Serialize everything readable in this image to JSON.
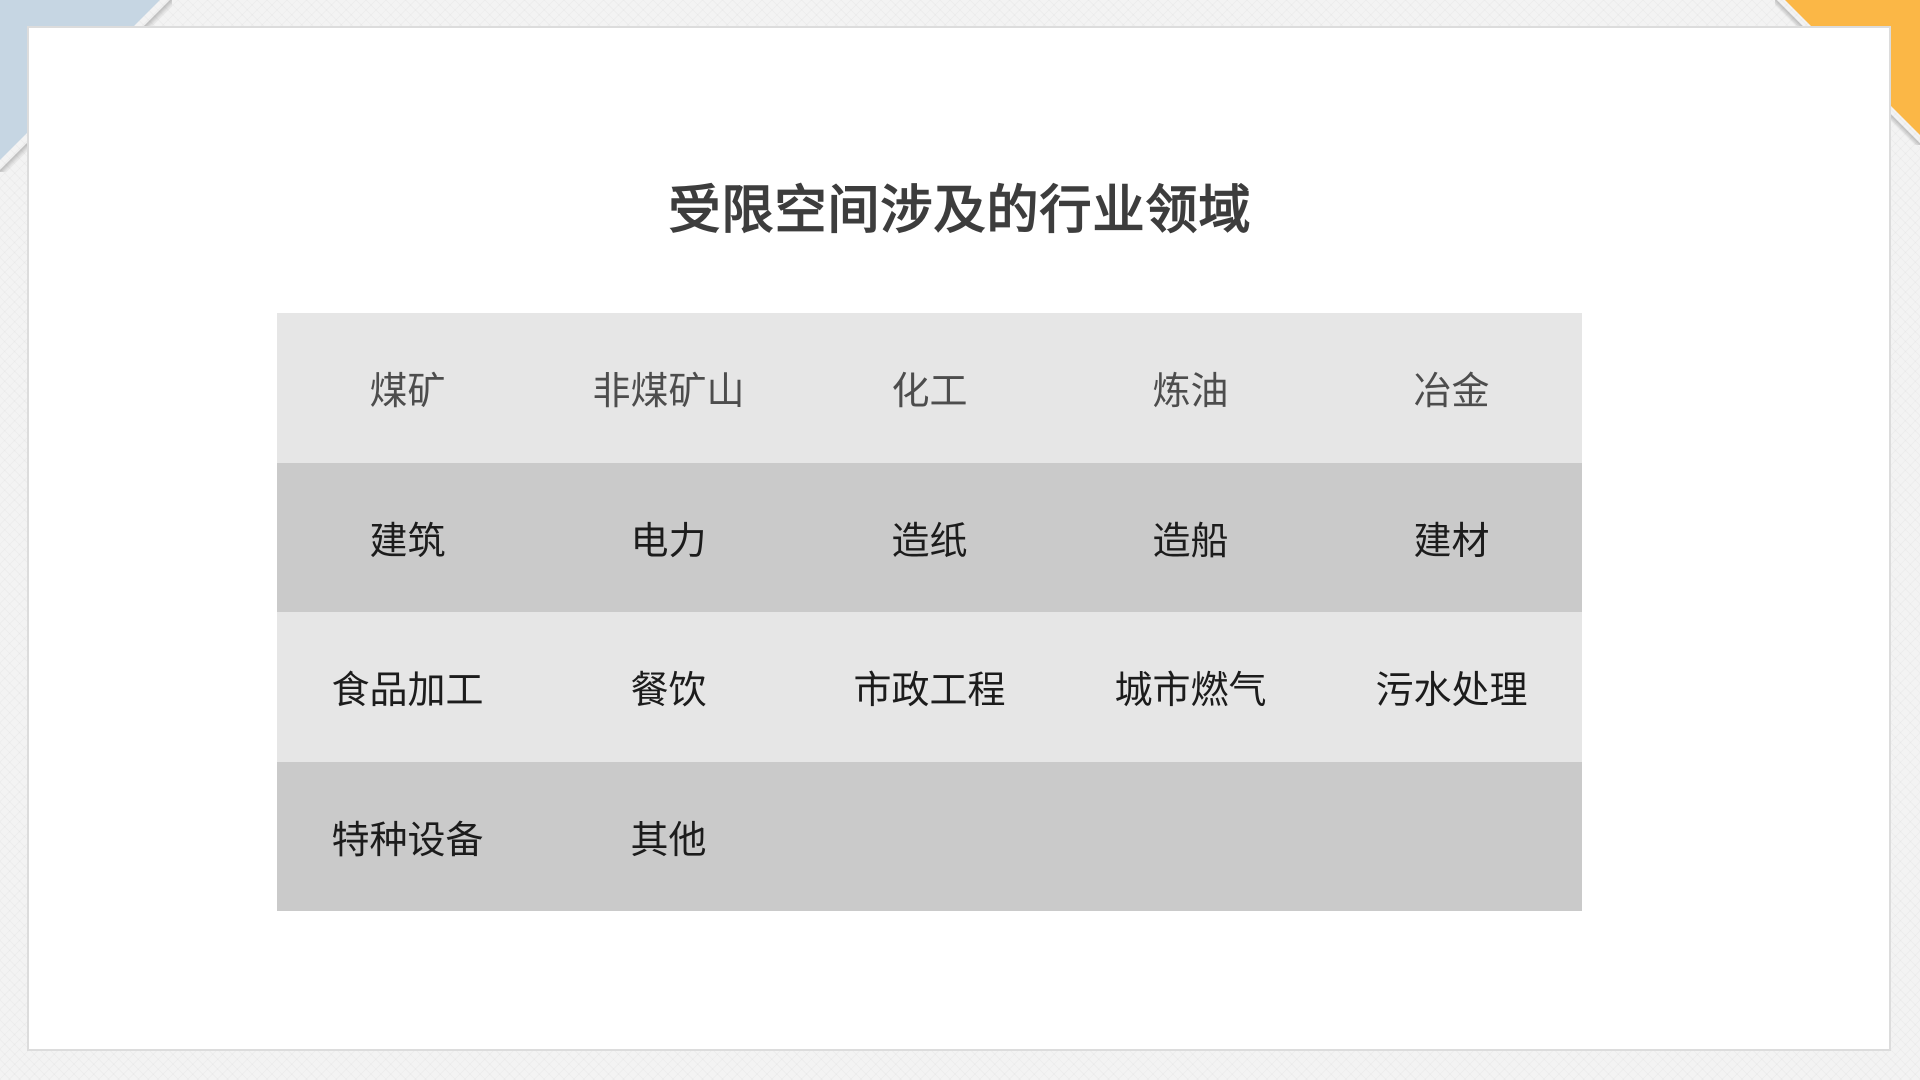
{
  "title": "受限空间涉及的行业领域",
  "colors": {
    "corner_left": "#c6d6e3",
    "corner_right": "#fbb746",
    "row_light": "#e6e6e6",
    "row_dark": "#cacaca"
  },
  "table": {
    "rows": [
      [
        "煤矿",
        "非煤矿山",
        "化工",
        "炼油",
        "冶金"
      ],
      [
        "建筑",
        "电力",
        "造纸",
        "造船",
        "建材"
      ],
      [
        "食品加工",
        "餐饮",
        "市政工程",
        "城市燃气",
        "污水处理"
      ],
      [
        "特种设备",
        "其他",
        "",
        "",
        ""
      ]
    ]
  }
}
